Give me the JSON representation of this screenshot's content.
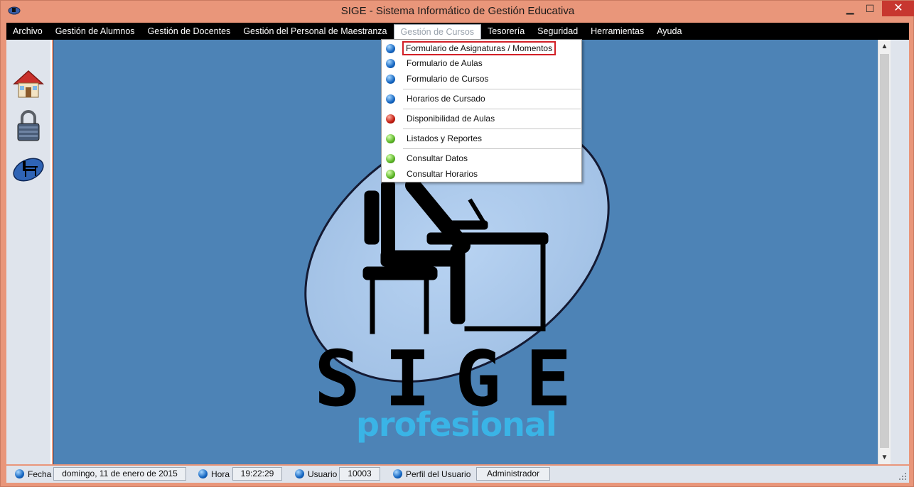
{
  "window": {
    "title": "SIGE - Sistema Informático de Gestión Educativa"
  },
  "titlebar_buttons": {
    "minimize": "▁",
    "maximize": "☐",
    "close": "✕"
  },
  "menu": [
    "Archivo",
    "Gestión de  Alumnos",
    "Gestión de Docentes",
    "Gestión del Personal de Maestranza",
    "Gestión de Cursos",
    "Tesorería",
    "Seguridad",
    "Herramientas",
    "Ayuda"
  ],
  "active_menu": "Gestión de Cursos",
  "dropdown": [
    {
      "label": "Formulario de Asignaturas / Momentos",
      "dot": "blue",
      "highlighted": true
    },
    {
      "label": "Formulario de Aulas",
      "dot": "blue"
    },
    {
      "label": "Formulario de Cursos",
      "dot": "blue"
    },
    {
      "label": "Horarios de Cursado",
      "dot": "blue"
    },
    {
      "label": "Disponibilidad de Aulas",
      "dot": "red"
    },
    {
      "label": "Listados y Reportes",
      "dot": "green"
    },
    {
      "label": "Consultar Datos",
      "dot": "green"
    },
    {
      "label": "Consultar Horarios",
      "dot": "green"
    }
  ],
  "toolbar_icons": [
    "house-icon",
    "padlock-icon",
    "desk-person-icon"
  ],
  "logo": {
    "main": "SIGE",
    "sub": "profesional"
  },
  "status": {
    "fecha_label": "Fecha",
    "fecha_value": "domingo, 11 de enero de 2015",
    "hora_label": "Hora",
    "hora_value": "19:22:29",
    "usuario_label": "Usuario",
    "usuario_value": "10003",
    "perfil_label": "Perfil del Usuario",
    "perfil_value": "Administrador"
  },
  "colors": {
    "frame": "#e9967a",
    "menubar": "#000000",
    "desktop": "#4d83b6",
    "ellipse": "#a8c6ea",
    "highlight_border": "#d21f26",
    "logo_sub": "#3ab4e6"
  }
}
